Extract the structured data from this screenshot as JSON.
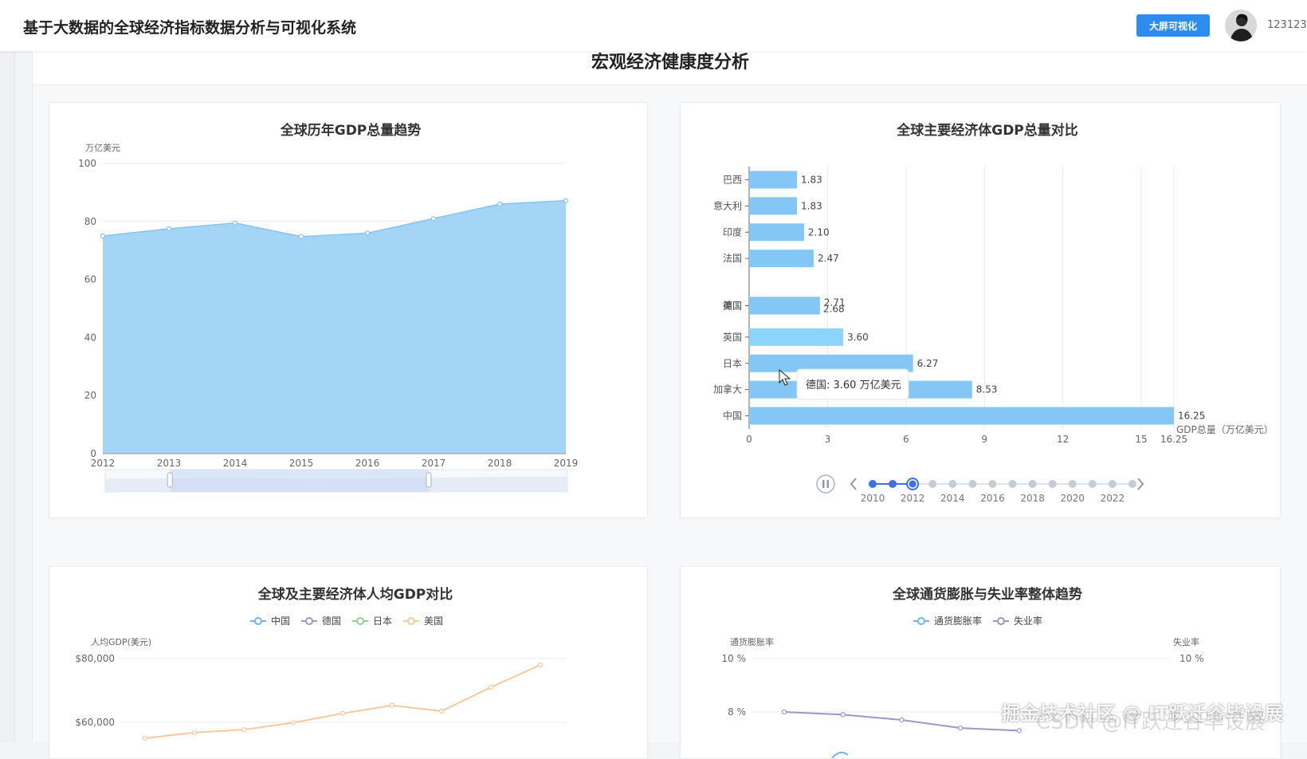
{
  "header": {
    "title": "基于大数据的全球经济指标数据分析与可视化系统",
    "big_screen_button": "大屏可视化",
    "username": "123123"
  },
  "page": {
    "section_title": "宏观经济健康度分析"
  },
  "colors": {
    "primary": "#2d8cf0",
    "area_fill": "#9fd3f7",
    "area_line": "#86c5ee",
    "bar": "#84c6f5",
    "bar_highlight": "#8dd4fb",
    "timeline": "#3b70e8"
  },
  "chart_data": [
    {
      "type": "area",
      "title": "全球历年GDP总量趋势",
      "ylabel": "万亿美元",
      "x": [
        "2012",
        "2013",
        "2014",
        "2015",
        "2016",
        "2017",
        "2018",
        "2019"
      ],
      "values": [
        75,
        77.5,
        79.5,
        74.8,
        76,
        81,
        86,
        87.2
      ],
      "ylim": [
        0,
        100
      ],
      "yticks": [
        "0",
        "20",
        "40",
        "60",
        "80",
        "100"
      ],
      "grid": true,
      "data_zoom": {
        "start": 0.14,
        "end": 0.7
      }
    },
    {
      "type": "bar",
      "title": "全球主要经济体GDP总量对比",
      "xlabel": "GDP总量（万亿美元）",
      "orientation": "horizontal",
      "categories": [
        "中国",
        "加拿大",
        "日本",
        "英国",
        "德国",
        "美国",
        "法国",
        "印度",
        "意大利",
        "巴西"
      ],
      "values": [
        16.25,
        8.53,
        6.27,
        3.6,
        2.68,
        2.71,
        2.47,
        2.1,
        1.83,
        1.83
      ],
      "value_labels": [
        "16.25",
        "8.53",
        "6.27",
        "3.60",
        "2.68",
        "2.71",
        "2.47",
        "2.10",
        "1.83",
        "1.83"
      ],
      "xticks": [
        "0",
        "3",
        "6",
        "9",
        "12",
        "15",
        "16.25"
      ],
      "xlim": [
        0,
        16.25
      ],
      "tooltip": "德国: 3.60 万亿美元",
      "timeline": {
        "years": [
          "2010",
          "2012",
          "2014",
          "2016",
          "2018",
          "2020",
          "2022"
        ],
        "points": 14,
        "current_index": 2
      }
    },
    {
      "type": "line",
      "title": "全球及主要经济体人均GDP对比",
      "ylabel": "人均GDP(美元)",
      "legend": [
        "中国",
        "德国",
        "日本",
        "美国"
      ],
      "legend_colors": [
        "#6db6ea",
        "#9b97c7",
        "#8fd48f",
        "#f6c99c"
      ],
      "yticks": [
        "$80,000",
        "$60,000"
      ],
      "series": [
        {
          "name": "美国",
          "values": [
            55000,
            56800,
            57700,
            59900,
            62800,
            65300,
            63500,
            71000,
            78000
          ]
        }
      ]
    },
    {
      "type": "line",
      "title": "全球通货膨胀与失业率整体趋势",
      "legend": [
        "通货膨胀率",
        "失业率"
      ],
      "legend_colors": [
        "#6db6ea",
        "#9b97c7"
      ],
      "ylabel_left": "通货膨胀率",
      "ylabel_right": "失业率",
      "yticks_left": [
        "10 %",
        "8 %"
      ],
      "yticks_right": [
        "10 %"
      ],
      "series": [
        {
          "name": "失业率",
          "values": [
            8.0,
            7.9,
            7.7,
            7.4,
            7.3
          ]
        }
      ]
    }
  ],
  "watermark": {
    "line1": "掘金技术社区 @ IT跃迁谷毕设展",
    "line2": "CSDN @IT跃迁谷毕设展"
  }
}
